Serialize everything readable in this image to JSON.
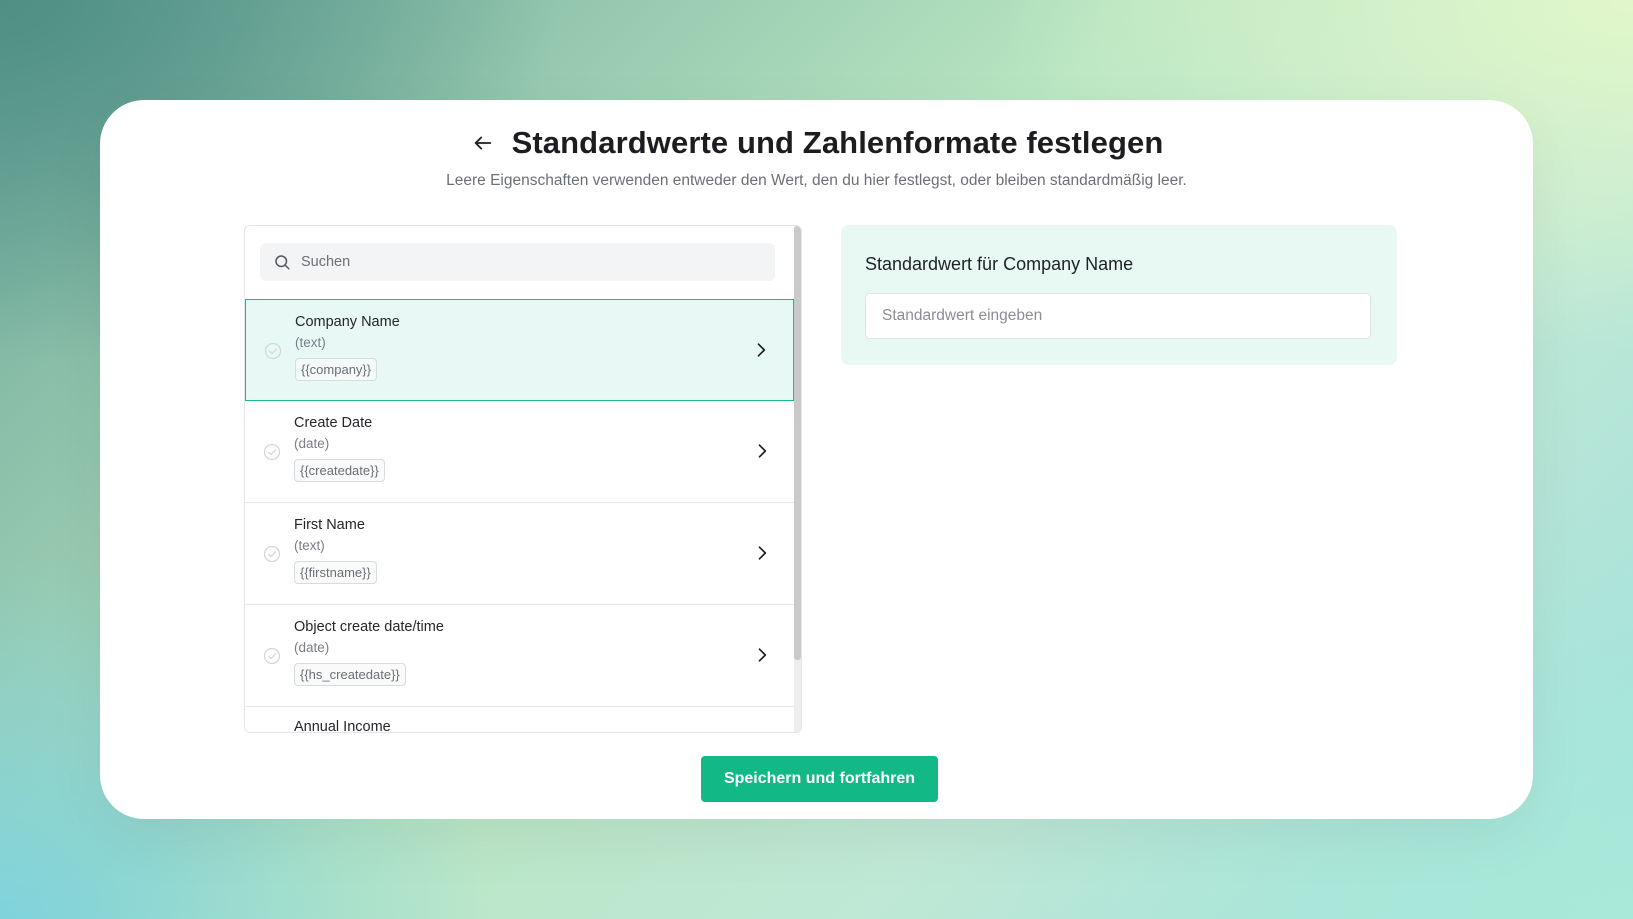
{
  "header": {
    "title": "Standardwerte und Zahlenformate festlegen",
    "subtitle": "Leere Eigenschaften verwenden entweder den Wert, den du hier festlegst, oder bleiben standardmäßig leer."
  },
  "search": {
    "placeholder": "Suchen"
  },
  "properties": [
    {
      "name": "Company Name",
      "type": "(text)",
      "token": "{{company}}",
      "selected": true
    },
    {
      "name": "Create Date",
      "type": "(date)",
      "token": "{{createdate}}",
      "selected": false
    },
    {
      "name": "First Name",
      "type": "(text)",
      "token": "{{firstname}}",
      "selected": false
    },
    {
      "name": "Object create date/time",
      "type": "(date)",
      "token": "{{hs_createdate}}",
      "selected": false
    },
    {
      "name": "Annual Income",
      "type": "",
      "token": "",
      "selected": false
    }
  ],
  "detail": {
    "label": "Standardwert für Company Name",
    "input_placeholder": "Standardwert eingeben"
  },
  "footer": {
    "save_label": "Speichern und fortfahren"
  },
  "colors": {
    "accent": "#12b886",
    "selected_bg": "#e8f8f5",
    "detail_bg": "#e8f8f3"
  },
  "icons": [
    "back-arrow-icon",
    "search-icon",
    "check-circle-icon",
    "chevron-right-icon"
  ]
}
